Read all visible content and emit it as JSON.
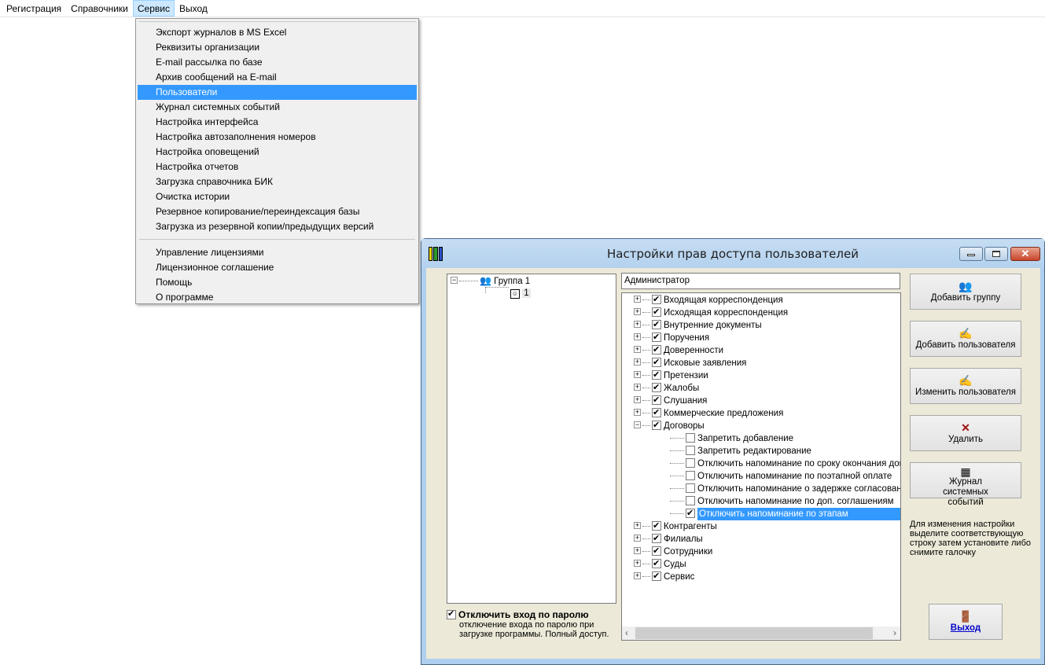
{
  "menubar": {
    "items": [
      "Регистрация",
      "Справочники",
      "Сервис",
      "Выход"
    ]
  },
  "dropdown": {
    "group1": [
      "Экспорт журналов в MS Excel",
      "Реквизиты организации",
      "E-mail рассылка по базе",
      "Архив сообщений на E-mail",
      "Пользователи",
      "Журнал системных событий",
      "Настройка интерфейса",
      "Настройка автозаполнения номеров",
      "Настройка оповещений",
      "Настройка отчетов",
      "Загрузка справочника БИК",
      "Очистка истории",
      "Резервное копирование/переиндексация базы",
      "Загрузка из резервной копии/предыдущих версий"
    ],
    "group2": [
      "Управление лицензиями",
      "Лицензионное соглашение",
      "Помощь",
      "О программе"
    ],
    "highlighted": "Пользователи"
  },
  "window": {
    "title": "Настройки прав доступа пользователей"
  },
  "groups_tree": {
    "group": "Группа 1",
    "user": "1"
  },
  "user_name": "Администратор",
  "rights": [
    {
      "label": "Входящая корреспонденция",
      "checked": true,
      "expander": "+"
    },
    {
      "label": "Исходящая корреспонденция",
      "checked": true,
      "expander": "+"
    },
    {
      "label": "Внутренние документы",
      "checked": true,
      "expander": "+"
    },
    {
      "label": "Поручения",
      "checked": true,
      "expander": "+"
    },
    {
      "label": "Доверенности",
      "checked": true,
      "expander": "+"
    },
    {
      "label": "Исковые заявления",
      "checked": true,
      "expander": "+"
    },
    {
      "label": "Претензии",
      "checked": true,
      "expander": "+"
    },
    {
      "label": "Жалобы",
      "checked": true,
      "expander": "+"
    },
    {
      "label": "Слушания",
      "checked": true,
      "expander": "+"
    },
    {
      "label": "Коммерческие предложения",
      "checked": true,
      "expander": "+"
    },
    {
      "label": "Договоры",
      "checked": true,
      "expander": "−"
    },
    {
      "label": "Запретить добавление",
      "checked": false,
      "child": true
    },
    {
      "label": "Запретить редактирование",
      "checked": false,
      "child": true
    },
    {
      "label": "Отключить напоминание по сроку окончания договора",
      "checked": false,
      "child": true
    },
    {
      "label": "Отключить напоминание по поэтапной оплате",
      "checked": false,
      "child": true
    },
    {
      "label": "Отключить напоминание о задержке согласования",
      "checked": false,
      "child": true
    },
    {
      "label": "Отключить напоминание по доп. соглашениям",
      "checked": false,
      "child": true
    },
    {
      "label": "Отключить напоминание по этапам",
      "checked": true,
      "child": true,
      "selected": true
    },
    {
      "label": "Контрагенты",
      "checked": true,
      "expander": "+"
    },
    {
      "label": "Филиалы",
      "checked": true,
      "expander": "+"
    },
    {
      "label": "Сотрудники",
      "checked": true,
      "expander": "+"
    },
    {
      "label": "Суды",
      "checked": true,
      "expander": "+"
    },
    {
      "label": "Сервис",
      "checked": true,
      "expander": "+"
    }
  ],
  "buttons": {
    "add_group": "Добавить группу",
    "add_user": "Добавить пользователя",
    "edit_user": "Изменить пользователя",
    "delete": "Удалить",
    "journal": "Журнал системных событий",
    "exit": "Выход"
  },
  "hint": "Для изменения настройки выделите соответствующую строку затем установите либо снимите галочку",
  "password": {
    "label": "Отключить вход по паролю",
    "checked": true,
    "desc": "отключение входа по паролю при загрузке программы. Полный доступ."
  },
  "colors": {
    "highlight": "#3399ff",
    "dialog_bg": "#ece9d8"
  }
}
